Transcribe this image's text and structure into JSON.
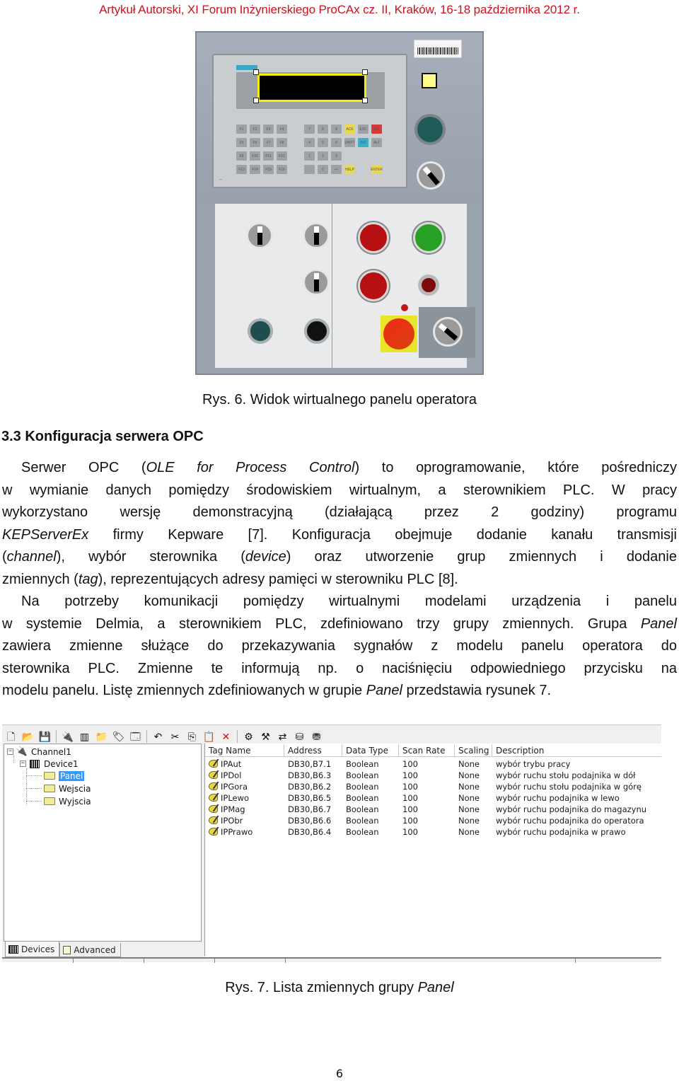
{
  "header": {
    "running_title": "Artykuł Autorski, XI Forum Inżynierskiego ProCAx cz. II, Kraków, 16-18 października 2012 r."
  },
  "figure6": {
    "caption": "Rys. 6. Widok wirtualnego panelu operatora",
    "panel": {
      "display_status": "selected",
      "function_keys": [
        "F1",
        "F2",
        "F3",
        "F4",
        "F5",
        "F6",
        "F7",
        "F8",
        "F9",
        "F10",
        "F11",
        "F12",
        "F13",
        "F14",
        "F15",
        "F16"
      ],
      "numeric_keys": [
        "7",
        "8",
        "9",
        "4",
        "5",
        "6",
        "1",
        "2",
        "3",
        ".",
        "0",
        "+/-"
      ],
      "special_keys": [
        "ACK",
        "ESC",
        "DEL",
        "SHIFT",
        "INS",
        "ALT",
        "HELP",
        "ENTER"
      ],
      "colors": {
        "highlight": "#f3ee10",
        "stop_button": "#b80f12",
        "start_button": "#27a026",
        "emergency_stop": "#f02a18",
        "lamp": "#fffc8a"
      }
    }
  },
  "section": {
    "title": "3.3 Konfiguracja serwera OPC"
  },
  "paragraph1": {
    "l1": [
      "Serwer OPC (",
      "OLE for Process Control",
      ") to oprogramowanie, które pośredniczy"
    ],
    "l2": "w wymianie danych pomiędzy środowiskiem wirtualnym, a sterownikiem PLC. W pracy",
    "l3": "wykorzystano wersję demonstracyjną (działającą przez 2 godziny) programu",
    "l4": [
      "KEPServerEx",
      " firmy Kepware [7]. Konfiguracja obejmuje dodanie kanału transmisji"
    ],
    "l5": [
      "(",
      "channel",
      "), wybór sterownika (",
      "device",
      ") oraz utworzenie grup zmiennych i dodanie"
    ],
    "l6": [
      "zmiennych (",
      "tag",
      "), reprezentujących adresy pamięci w sterowniku PLC [8]."
    ]
  },
  "paragraph2": {
    "l1": "Na potrzeby komunikacji pomiędzy wirtualnymi modelami urządzenia i panelu",
    "l2": [
      "w systemie Delmia, a sterownikiem PLC, zdefiniowano trzy grupy zmiennych. Grupa ",
      "Panel"
    ],
    "l3": "zawiera zmienne służące do przekazywania sygnałów z modelu panelu operatora do",
    "l4": "sterownika PLC. Zmienne te informują np. o naciśnięciu odpowiedniego przycisku na",
    "l5": [
      "modelu panelu. Listę zmiennych zdefiniowanych w grupie ",
      "Panel",
      " przedstawia rysunek 7."
    ]
  },
  "figure7": {
    "caption_prefix": "Rys. 7. Lista zmiennych grupy ",
    "caption_italic": "Panel",
    "toolbar": [
      {
        "icon": "new-icon",
        "glyph": "🗋"
      },
      {
        "icon": "open-icon",
        "glyph": "📂"
      },
      {
        "icon": "save-icon",
        "glyph": "💾"
      },
      {
        "sep": true
      },
      {
        "icon": "new-channel-icon",
        "glyph": "🔌"
      },
      {
        "icon": "new-device-icon",
        "glyph": "▥"
      },
      {
        "icon": "new-group-icon",
        "glyph": "📁"
      },
      {
        "icon": "new-tag-icon",
        "glyph": "🏷"
      },
      {
        "icon": "properties-icon",
        "glyph": "🗔"
      },
      {
        "sep": true
      },
      {
        "icon": "undo-icon",
        "glyph": "↶"
      },
      {
        "icon": "cut-icon",
        "glyph": "✂"
      },
      {
        "icon": "copy-icon",
        "glyph": "⎘"
      },
      {
        "icon": "paste-icon",
        "glyph": "📋"
      },
      {
        "icon": "delete-icon",
        "glyph": "✕"
      },
      {
        "sep": true
      },
      {
        "icon": "quick-client-icon",
        "glyph": "⚙"
      },
      {
        "icon": "opc-icon",
        "glyph": "⚒"
      },
      {
        "icon": "import-icon",
        "glyph": "⇄"
      },
      {
        "icon": "database-icon",
        "glyph": "⛁"
      },
      {
        "icon": "database-config-icon",
        "glyph": "⛃"
      }
    ],
    "tree": {
      "channel": "Channel1",
      "device": "Device1",
      "groups": [
        {
          "label": "Panel",
          "selected": true
        },
        {
          "label": "Wejscia",
          "selected": false
        },
        {
          "label": "Wyjscia",
          "selected": false
        }
      ]
    },
    "tabs": [
      {
        "label": "Devices",
        "active": true
      },
      {
        "label": "Advanced",
        "active": false
      }
    ],
    "columns": [
      "Tag Name",
      "Address",
      "Data Type",
      "Scan Rate",
      "Scaling",
      "Description"
    ],
    "rows": [
      [
        "IPAut",
        "DB30,B7.1",
        "Boolean",
        "100",
        "None",
        "wybór trybu pracy"
      ],
      [
        "IPDol",
        "DB30,B6.3",
        "Boolean",
        "100",
        "None",
        "wybór ruchu stołu podajnika w dół"
      ],
      [
        "IPGora",
        "DB30,B6.2",
        "Boolean",
        "100",
        "None",
        "wybór ruchu stołu podajnika w górę"
      ],
      [
        "IPLewo",
        "DB30,B6.5",
        "Boolean",
        "100",
        "None",
        "wybór ruchu podajnika w lewo"
      ],
      [
        "IPMag",
        "DB30,B6.7",
        "Boolean",
        "100",
        "None",
        "wybór ruchu podajnika do magazynu"
      ],
      [
        "IPObr",
        "DB30,B6.6",
        "Boolean",
        "100",
        "None",
        "wybór ruchu podajnika do operatora"
      ],
      [
        "IPPrawo",
        "DB30,B6.4",
        "Boolean",
        "100",
        "None",
        "wybór ruchu podajnika w prawo"
      ]
    ]
  },
  "footer": {
    "page_number": "6"
  }
}
